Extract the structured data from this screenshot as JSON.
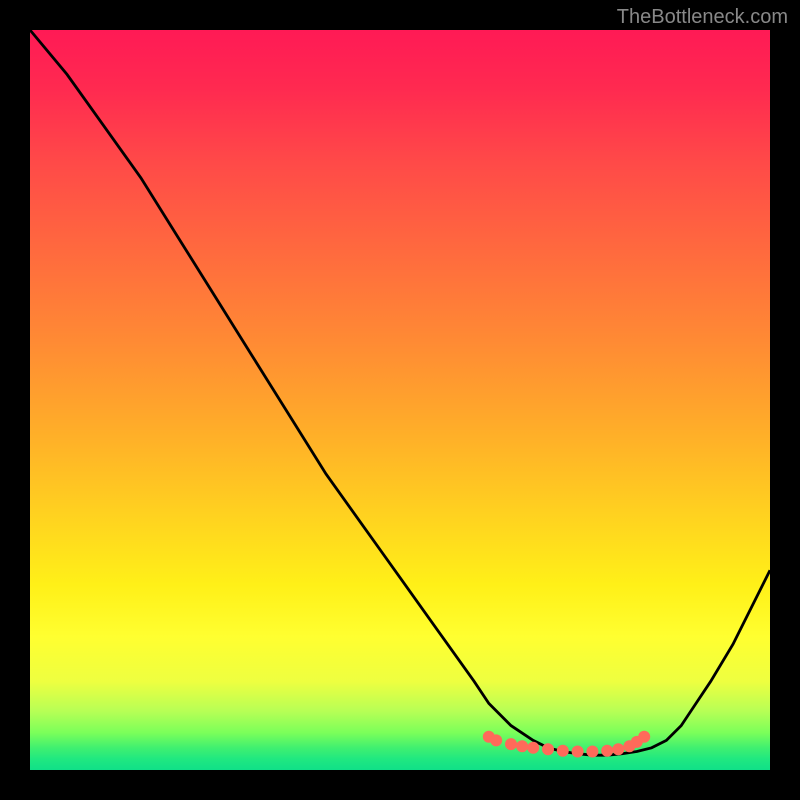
{
  "watermark": "TheBottleneck.com",
  "chart_data": {
    "type": "line",
    "title": "",
    "xlabel": "",
    "ylabel": "",
    "xlim": [
      0,
      100
    ],
    "ylim": [
      0,
      100
    ],
    "series": [
      {
        "name": "curve",
        "x": [
          0,
          5,
          10,
          15,
          20,
          25,
          30,
          35,
          40,
          45,
          50,
          55,
          60,
          62,
          65,
          68,
          70,
          72,
          74,
          76,
          78,
          80,
          82,
          84,
          86,
          88,
          90,
          92,
          95,
          100
        ],
        "y": [
          100,
          94,
          87,
          80,
          72,
          64,
          56,
          48,
          40,
          33,
          26,
          19,
          12,
          9,
          6,
          4,
          3,
          2.5,
          2.2,
          2,
          2,
          2.2,
          2.5,
          3,
          4,
          6,
          9,
          12,
          17,
          27
        ]
      }
    ],
    "markers": [
      {
        "x": 62,
        "y": 4.5
      },
      {
        "x": 63,
        "y": 4.0
      },
      {
        "x": 65,
        "y": 3.5
      },
      {
        "x": 66.5,
        "y": 3.2
      },
      {
        "x": 68,
        "y": 3.0
      },
      {
        "x": 70,
        "y": 2.8
      },
      {
        "x": 72,
        "y": 2.6
      },
      {
        "x": 74,
        "y": 2.5
      },
      {
        "x": 76,
        "y": 2.5
      },
      {
        "x": 78,
        "y": 2.6
      },
      {
        "x": 79.5,
        "y": 2.8
      },
      {
        "x": 81,
        "y": 3.2
      },
      {
        "x": 82,
        "y": 3.8
      },
      {
        "x": 83,
        "y": 4.5
      }
    ],
    "marker_color": "#ff6a5a",
    "curve_color": "#000000",
    "gradient_stops": [
      {
        "pos": 0,
        "color": "#ff1a55"
      },
      {
        "pos": 50,
        "color": "#ffb028"
      },
      {
        "pos": 82,
        "color": "#ffff30"
      },
      {
        "pos": 100,
        "color": "#10e088"
      }
    ]
  }
}
